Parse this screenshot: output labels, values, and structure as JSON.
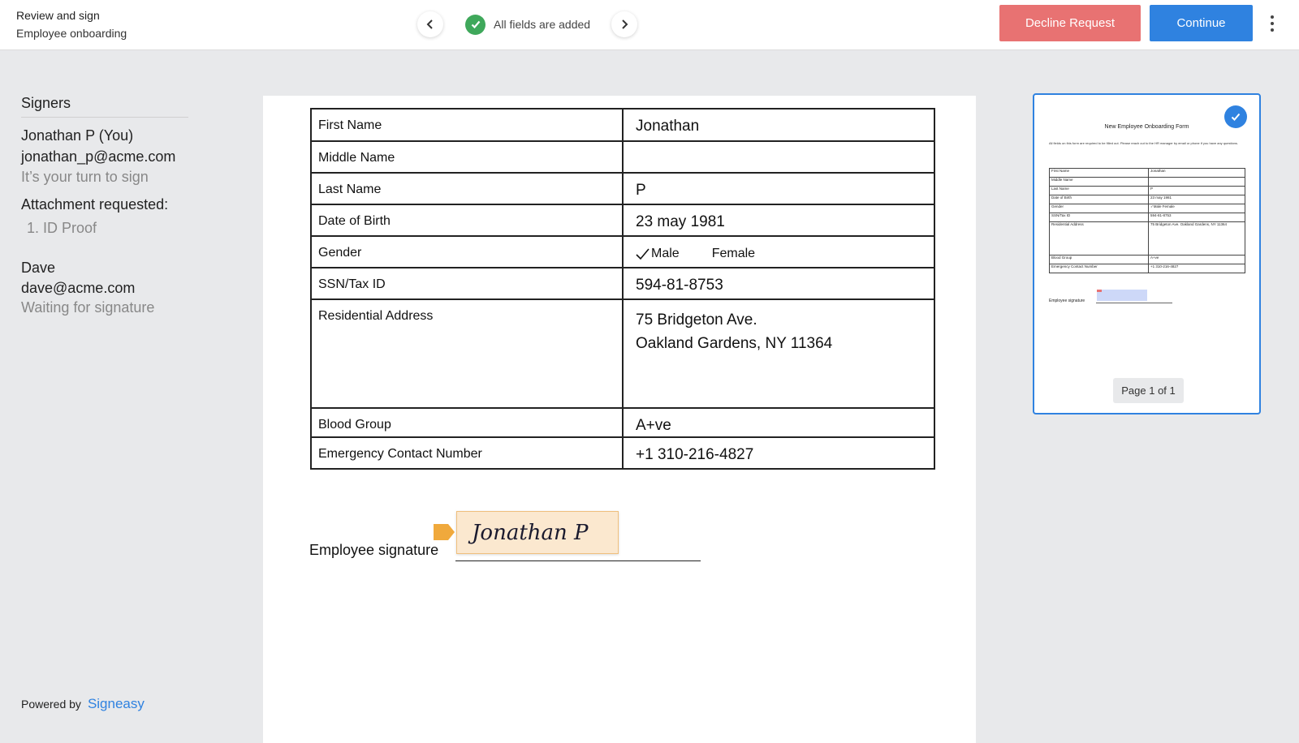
{
  "header": {
    "title": "Review and sign",
    "subtitle": "Employee onboarding",
    "status_text": "All fields are added",
    "decline_label": "Decline Request",
    "continue_label": "Continue"
  },
  "sidebar": {
    "heading": "Signers",
    "signers": [
      {
        "name": "Jonathan P (You)",
        "email": "jonathan_p@acme.com",
        "status": "It’s your turn to sign"
      },
      {
        "name": "Dave",
        "email": "dave@acme.com",
        "status": "Waiting for signature"
      }
    ],
    "attachment_heading": "Attachment requested:",
    "attachments": [
      "1. ID Proof"
    ],
    "powered_by": "Powered by",
    "brand": "Signeasy"
  },
  "document": {
    "rows": [
      {
        "label": "First Name",
        "value": "Jonathan"
      },
      {
        "label": "Middle Name",
        "value": ""
      },
      {
        "label": "Last Name",
        "value": "P"
      },
      {
        "label": "Date of Birth",
        "value": "23 may 1981"
      },
      {
        "label": "Gender",
        "options": [
          "Male",
          "Female"
        ],
        "selected": "Male"
      },
      {
        "label": "SSN/Tax ID",
        "value": "594-81-8753"
      },
      {
        "label": "Residential Address",
        "value_lines": [
          "75 Bridgeton Ave.",
          "Oakland Gardens, NY 11364"
        ]
      },
      {
        "label": "Blood Group",
        "value": "A+ve"
      },
      {
        "label": "Emergency Contact Number",
        "value": "+1 310-216-4827"
      }
    ],
    "signature_label": "Employee signature",
    "signature_text": "Jonathan P"
  },
  "thumbnail": {
    "title": "New Employee Onboarding Form",
    "description": "All fields on this form are required to be filled out. Please reach out to the HR manager by email or phone if you have any questions.",
    "rows": [
      {
        "label": "First Name",
        "value": "Jonathan"
      },
      {
        "label": "Middle Name",
        "value": ""
      },
      {
        "label": "Last Name",
        "value": "P"
      },
      {
        "label": "Date of Birth",
        "value": "23 may 1981"
      },
      {
        "label": "Gender",
        "value": "✓Male      Female"
      },
      {
        "label": "SSN/Tax ID",
        "value": "594-81-8753"
      },
      {
        "label": "Residential Address",
        "value": "75 Bridgeton Ave. Oakland Gardens, NY 11364"
      },
      {
        "label": "Blood Group",
        "value": "A+ve"
      },
      {
        "label": "Emergency Contact Number",
        "value": "+1 310-216-4827"
      }
    ],
    "signature_label": "Employee signature",
    "page_indicator": "Page 1 of 1"
  },
  "colors": {
    "accent": "#2f82e0",
    "decline": "#e87272",
    "success": "#3fa85b",
    "signature_bg": "#fbe8cf",
    "signature_tag": "#f0a93c"
  },
  "icons": [
    "chevron-left-icon",
    "chevron-right-icon",
    "check-circle-icon",
    "more-vertical-icon",
    "check-icon",
    "signature-tag-icon"
  ]
}
